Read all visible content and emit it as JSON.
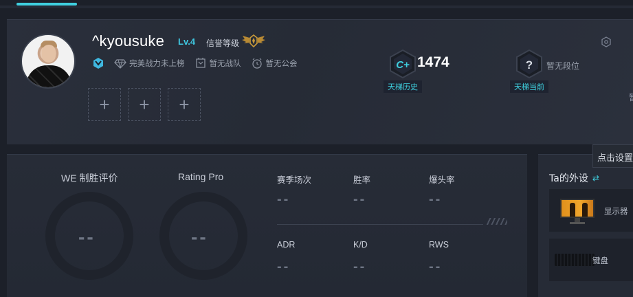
{
  "profile": {
    "username": "^kyousuke",
    "level": "Lv.4",
    "credit_label": "信誉等级",
    "power_rank": "完美战力未上榜",
    "team": "暂无战队",
    "guild": "暂无公会"
  },
  "ladder": {
    "history_badge": "C+",
    "history_score": "1474",
    "history_caption": "天梯历史",
    "current_badge": "?",
    "current_caption": "天梯当前",
    "current_rank": "暂无段位",
    "edge_char": "暂"
  },
  "stats": {
    "we_title": "WE 制胜评价",
    "we_value": "--",
    "rating_title": "Rating Pro",
    "rating_value": "--",
    "grid": [
      {
        "label": "赛季场次",
        "value": "--"
      },
      {
        "label": "胜率",
        "value": "--"
      },
      {
        "label": "爆头率",
        "value": "--"
      },
      {
        "label": "ADR",
        "value": "--"
      },
      {
        "label": "K/D",
        "value": "--"
      },
      {
        "label": "RWS",
        "value": "--"
      }
    ]
  },
  "gear": {
    "title": "Ta的外设",
    "monitor_label": "显示器",
    "keyboard_label": "键盘"
  },
  "tooltip": {
    "text": "点击设置"
  },
  "colors": {
    "accent": "#3fd0e0",
    "level": "#3fc7e0",
    "background": "#1c2029"
  },
  "icons": {
    "add": "+",
    "swap": "⇄"
  }
}
